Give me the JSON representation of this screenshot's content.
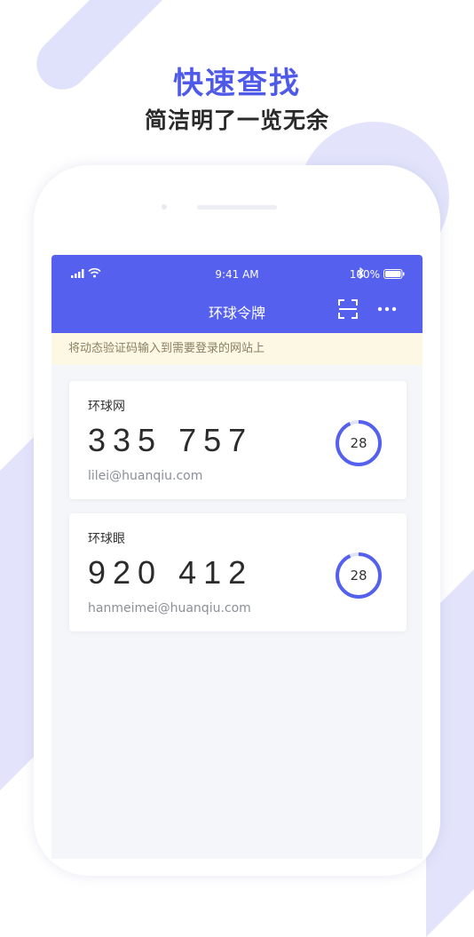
{
  "promo": {
    "title": "快速查找",
    "subtitle": "简洁明了一览无余"
  },
  "status_bar": {
    "time": "9:41 AM",
    "battery": "100%"
  },
  "nav": {
    "title": "环球令牌",
    "scan_icon": "scan-icon",
    "more_icon": "more-icon"
  },
  "notice": "将动态验证码输入到需要登录的网站上",
  "tokens": [
    {
      "site": "环球网",
      "code": "335 757",
      "account": "lilei@huanqiu.com",
      "timer": "28",
      "timer_fraction": 0.933
    },
    {
      "site": "环球眼",
      "code": "920 412",
      "account": "hanmeimei@huanqiu.com",
      "timer": "28",
      "timer_fraction": 0.933
    }
  ],
  "colors": {
    "accent": "#5560ee",
    "notice_bg": "#fdf8e3",
    "decoration": "#e3e4fb"
  }
}
